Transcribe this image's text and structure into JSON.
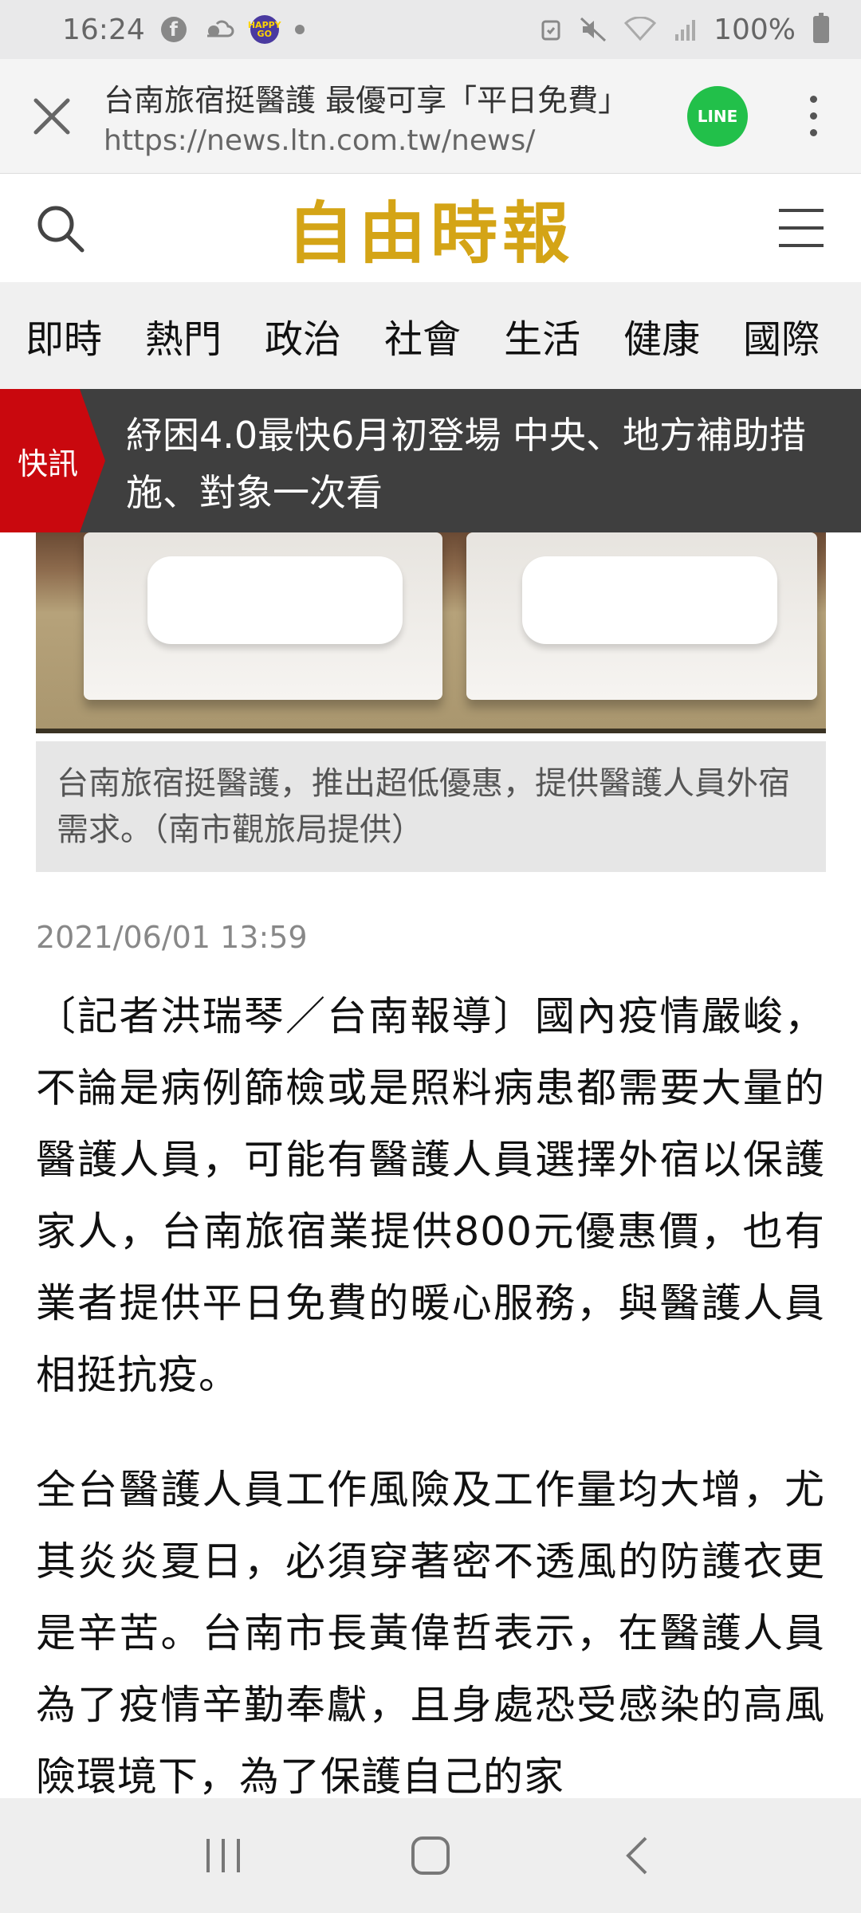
{
  "status_bar": {
    "time": "16:24",
    "fb_glyph": "f",
    "happygo_text": "HAPPY GO",
    "battery": "100%"
  },
  "tab_bar": {
    "title": "台南旅宿挺醫護 最優可享「平日免費」",
    "url": "https://news.ltn.com.tw/news/",
    "share_label": "LINE"
  },
  "site_header": {
    "logo": "自由時報"
  },
  "categories": [
    "即時",
    "熱門",
    "政治",
    "社會",
    "生活",
    "健康",
    "國際"
  ],
  "breaking": {
    "tag": "快訊",
    "text": "紓困4.0最快6月初登場 中央、地方補助措施、對象一次看"
  },
  "article": {
    "caption": "台南旅宿挺醫護，推出超低優惠，提供醫護人員外宿需求。（南市觀旅局提供）",
    "date": "2021/06/01 13:59",
    "para1": "〔記者洪瑞琴／台南報導〕國內疫情嚴峻，不論是病例篩檢或是照料病患都需要大量的醫護人員，可能有醫護人員選擇外宿以保護家人，台南旅宿業提供800元優惠價，也有業者提供平日免費的暖心服務，與醫護人員相挺抗疫。",
    "para2": "全台醫護人員工作風險及工作量均大增，尤其炎炎夏日，必須穿著密不透風的防護衣更是辛苦。台南市長黃偉哲表示，在醫護人員為了疫情辛勤奉獻，且身處恐受感染的高風險環境下，為了保護自己的家"
  },
  "colors": {
    "brand_gold": "#d4a416",
    "breaking_red": "#c9080e",
    "breaking_bg": "#3f3f3f",
    "line_green": "#22c04a"
  },
  "icons": {
    "close": "close-icon",
    "search": "search-icon",
    "menu": "hamburger-menu-icon",
    "kebab": "more-options-icon",
    "recents": "recents-icon",
    "home": "home-icon",
    "back": "back-icon"
  }
}
